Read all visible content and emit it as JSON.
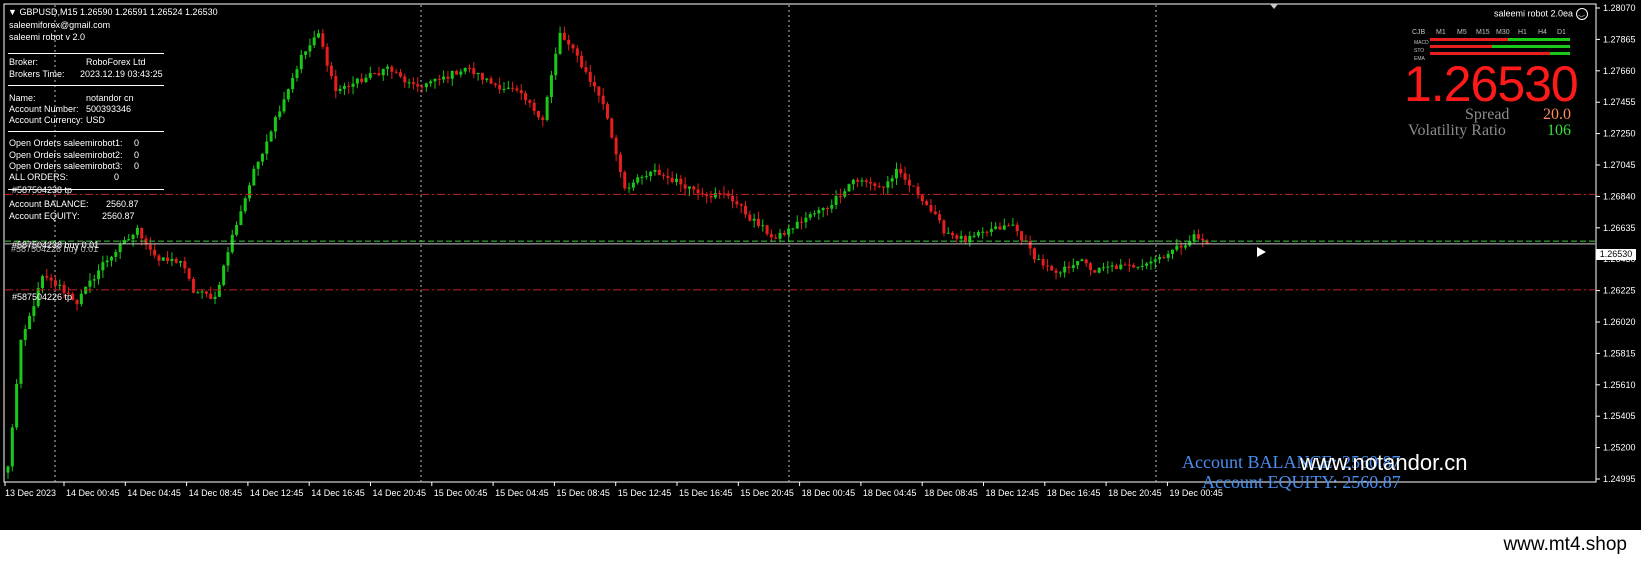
{
  "symbol_header": "GBPUSD,M15  1.26590 1.26591 1.26524 1.26530",
  "header_lines": [
    "saleemiforex@gmail.com",
    "saleemi robot v 2.0"
  ],
  "info": {
    "broker_label": "Broker:",
    "broker_value": "RoboForex Ltd",
    "time_label": "Brokers Time:",
    "time_value": "2023.12.19 03:43:25",
    "name_label": "Name:",
    "name_value": "notandor cn",
    "acc_num_label": "Account Number:",
    "acc_num_value": "500393346",
    "currency_label": "Account Currency:",
    "currency_value": "USD",
    "open1_label": "Open Orders saleemirobot1:",
    "open1_value": "0",
    "open2_label": "Open Orders saleemirobot2:",
    "open2_value": "0",
    "open3_label": "Open Orders saleemirobot3:",
    "open3_value": "0",
    "all_label": "ALL ORDERS:",
    "all_value": "0",
    "order_tag": "#587504238 tp",
    "balance_label": "Account BALANCE:",
    "balance_value": "2560.87",
    "equity_label": "Account EQUITY:",
    "equity_value": "2560.87"
  },
  "order_labels": {
    "buy_label": "#587504238 buy 0.01",
    "buy_label_ghost": "#587504226 buy 0.01",
    "tp_label": "#587504226 tp"
  },
  "ea_title": "saleemi robot 2.0ea",
  "ea_icon": "smiley-icon",
  "tf_labels": [
    "CJB",
    "M1",
    "M5",
    "M15",
    "M30",
    "H1",
    "H4",
    "D1"
  ],
  "signal_row_labels": [
    "MACD",
    "STO",
    "EMA"
  ],
  "big_price": "1.26530",
  "spread_label": "Spread",
  "spread_value": "20.0",
  "volatility_label": "Volatility Ratio",
  "volatility_value": "106",
  "bottom_balance": "Account BALANCE:  2560.87",
  "bottom_equity": "Account EQUITY:  2560.87",
  "watermark_chart": "www.notandor.cn",
  "watermark_bottom": "www.mt4.shop",
  "current_price_tag": "1.26530",
  "y_ticks": [
    "1.28070",
    "1.27865",
    "1.27660",
    "1.27455",
    "1.27250",
    "1.27045",
    "1.26840",
    "1.26635",
    "1.26430",
    "1.26225",
    "1.26020",
    "1.25815",
    "1.25610",
    "1.25405",
    "1.25200",
    "1.24995"
  ],
  "x_ticks": [
    "13 Dec 2023",
    "14 Dec 00:45",
    "14 Dec 04:45",
    "14 Dec 08:45",
    "14 Dec 12:45",
    "14 Dec 16:45",
    "14 Dec 20:45",
    "15 Dec 00:45",
    "15 Dec 04:45",
    "15 Dec 08:45",
    "15 Dec 12:45",
    "15 Dec 16:45",
    "15 Dec 20:45",
    "18 Dec 00:45",
    "18 Dec 04:45",
    "18 Dec 08:45",
    "18 Dec 12:45",
    "18 Dec 16:45",
    "18 Dec 20:45",
    "19 Dec 00:45"
  ],
  "colors": {
    "bull": "#19c819",
    "bear": "#e61e1e",
    "tp_line": "#c81e1e",
    "order_line": "#3ccc3c",
    "price_line": "#c8c8c8",
    "big_price": "#ff1a1a",
    "spread_value": "#ff8c5a",
    "volatility_value": "#3cdc3c",
    "account_text": "#4a8ff0"
  },
  "chart_data": {
    "type": "candlestick",
    "symbol": "GBPUSD",
    "timeframe": "M15",
    "ylim": [
      1.24995,
      1.2807
    ],
    "tp_levels": [
      1.26853,
      1.2623
    ],
    "order_price": 1.26548,
    "current_price": 1.2653,
    "anchors": [
      [
        0,
        1.2507
      ],
      [
        3,
        1.2588
      ],
      [
        8,
        1.2631
      ],
      [
        12,
        1.2625
      ],
      [
        16,
        1.2615
      ],
      [
        22,
        1.264
      ],
      [
        30,
        1.2662
      ],
      [
        35,
        1.2642
      ],
      [
        40,
        1.2642
      ],
      [
        43,
        1.2622
      ],
      [
        48,
        1.2618
      ],
      [
        52,
        1.2658
      ],
      [
        57,
        1.27
      ],
      [
        62,
        1.2735
      ],
      [
        68,
        1.2775
      ],
      [
        72,
        1.279
      ],
      [
        76,
        1.2753
      ],
      [
        82,
        1.276
      ],
      [
        88,
        1.2768
      ],
      [
        94,
        1.2755
      ],
      [
        100,
        1.276
      ],
      [
        106,
        1.2768
      ],
      [
        112,
        1.2758
      ],
      [
        118,
        1.2752
      ],
      [
        124,
        1.2735
      ],
      [
        128,
        1.279
      ],
      [
        132,
        1.2775
      ],
      [
        138,
        1.2745
      ],
      [
        143,
        1.269
      ],
      [
        150,
        1.27
      ],
      [
        158,
        1.269
      ],
      [
        163,
        1.2685
      ],
      [
        167,
        1.2685
      ],
      [
        172,
        1.267
      ],
      [
        178,
        1.2656
      ],
      [
        185,
        1.267
      ],
      [
        190,
        1.2677
      ],
      [
        196,
        1.2695
      ],
      [
        203,
        1.269
      ],
      [
        206,
        1.27
      ],
      [
        212,
        1.2683
      ],
      [
        217,
        1.2662
      ],
      [
        222,
        1.2655
      ],
      [
        228,
        1.2662
      ],
      [
        233,
        1.2665
      ],
      [
        238,
        1.2645
      ],
      [
        243,
        1.2632
      ],
      [
        248,
        1.2643
      ],
      [
        252,
        1.2635
      ],
      [
        256,
        1.2638
      ],
      [
        260,
        1.2638
      ],
      [
        266,
        1.2643
      ],
      [
        271,
        1.265
      ],
      [
        275,
        1.2658
      ],
      [
        278,
        1.2653
      ]
    ]
  }
}
